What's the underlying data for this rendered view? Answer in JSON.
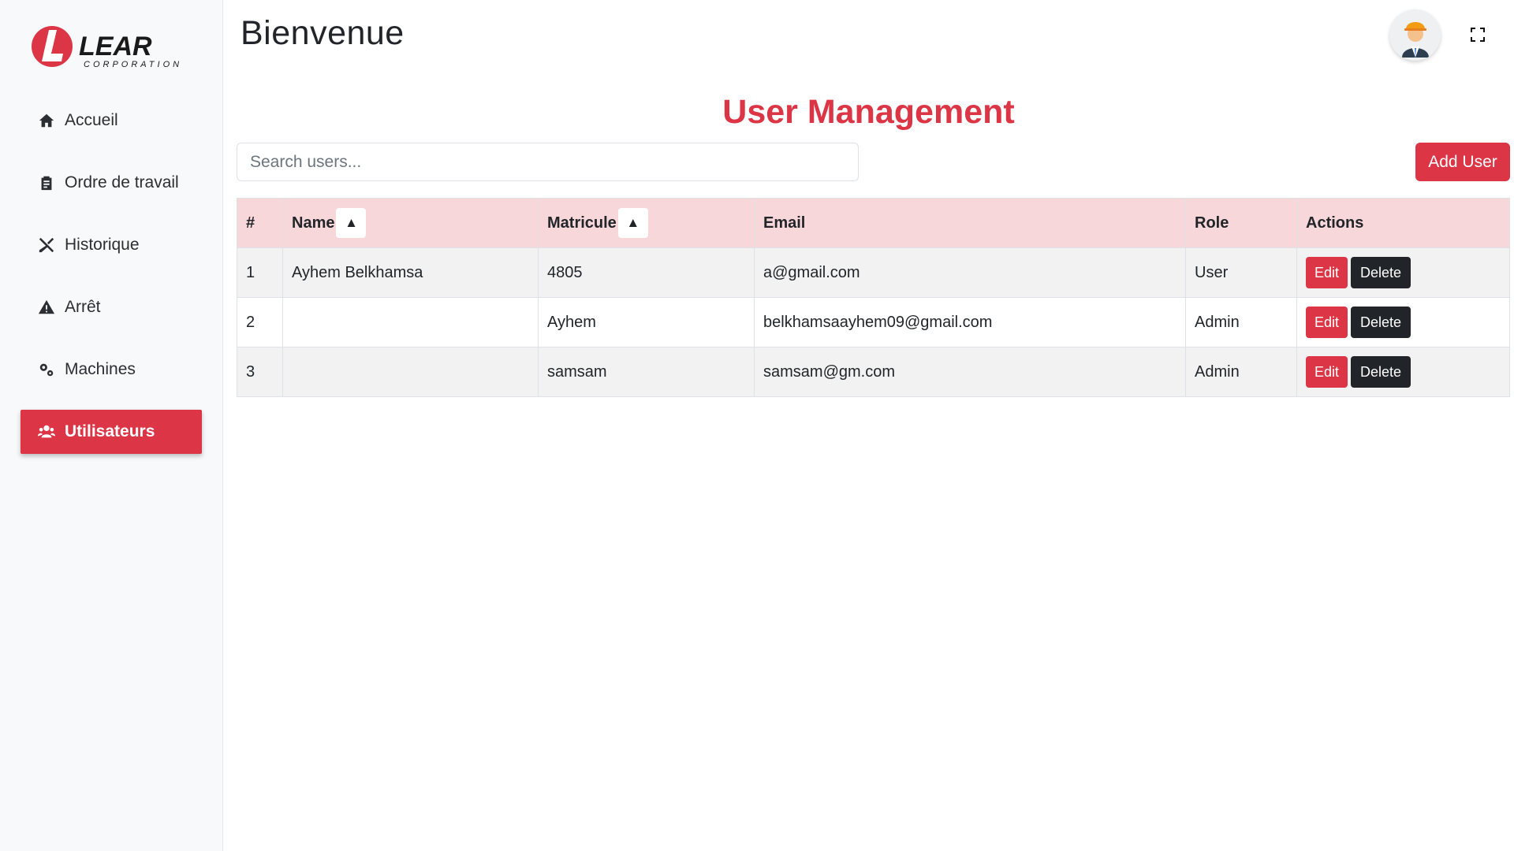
{
  "brand": {
    "logo_text": "LEAR",
    "logo_subtext": "CORPORATION",
    "brand_color": "#dc3545"
  },
  "sidebar": {
    "items": [
      {
        "label": "Accueil",
        "icon": "home-icon"
      },
      {
        "label": "Ordre de travail",
        "icon": "clipboard-icon"
      },
      {
        "label": "Historique",
        "icon": "tools-icon"
      },
      {
        "label": "Arrêt",
        "icon": "warning-icon"
      },
      {
        "label": "Machines",
        "icon": "gears-icon"
      },
      {
        "label": "Utilisateurs",
        "icon": "users-icon",
        "active": true
      }
    ]
  },
  "header": {
    "title": "Bienvenue",
    "avatar_icon": "worker-avatar-icon",
    "fullscreen_icon": "expand-icon"
  },
  "main": {
    "title": "User Management",
    "search": {
      "placeholder": "Search users...",
      "value": ""
    },
    "add_button": "Add User",
    "table": {
      "headers": [
        "#",
        "Name",
        "Matricule",
        "Email",
        "Role",
        "Actions"
      ],
      "sort_indicator": "▲",
      "rows": [
        {
          "num": "1",
          "name": "Ayhem Belkhamsa",
          "matricule": "4805",
          "email": "a@gmail.com",
          "role": "User"
        },
        {
          "num": "2",
          "name": "",
          "matricule": "Ayhem",
          "email": "belkhamsaayhem09@gmail.com",
          "role": "Admin"
        },
        {
          "num": "3",
          "name": "",
          "matricule": "samsam",
          "email": "samsam@gm.com",
          "role": "Admin"
        }
      ],
      "edit_label": "Edit",
      "delete_label": "Delete"
    }
  }
}
